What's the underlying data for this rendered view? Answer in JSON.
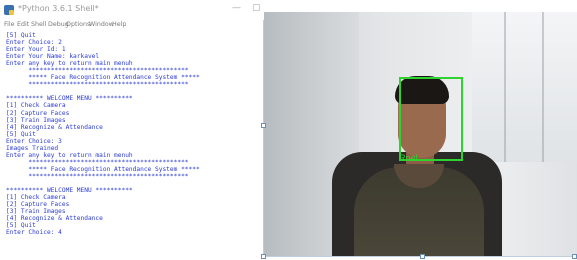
{
  "window": {
    "title": "*Python 3.6.1 Shell*",
    "minimize_glyph": "—",
    "maximize_glyph": "▢"
  },
  "menu": [
    "File",
    "Edit",
    "Shell",
    "Debug",
    "Options",
    "Window",
    "Help"
  ],
  "console_lines": [
    "[5] Quit",
    "Enter Choice: 2",
    "Enter Your Id: 1",
    "Enter Your Name: karkavel",
    "Enter any key to return main menuh",
    "      *******************************************",
    "      ***** Face Recognition Attendance System *****",
    "      *******************************************",
    "",
    "********** WELCOME MENU **********",
    "[1] Check Camera",
    "[2] Capture Faces",
    "[3] Train Images",
    "[4] Recognize & Attendance",
    "[5] Quit",
    "Enter Choice: 3",
    "Images Trained",
    "Enter any key to return main menuh",
    "      *******************************************",
    "      ***** Face Recognition Attendance System *****",
    "      *******************************************",
    "",
    "********** WELCOME MENU **********",
    "[1] Check Camera",
    "[2] Capture Faces",
    "[3] Train Images",
    "[4] Recognize & Attendance",
    "[5] Quit",
    "Enter Choice: 4"
  ],
  "camera": {
    "face_label": "Roel",
    "box_color": "#2fd32f"
  },
  "colors": {
    "console_text": "#2b3cd4"
  }
}
